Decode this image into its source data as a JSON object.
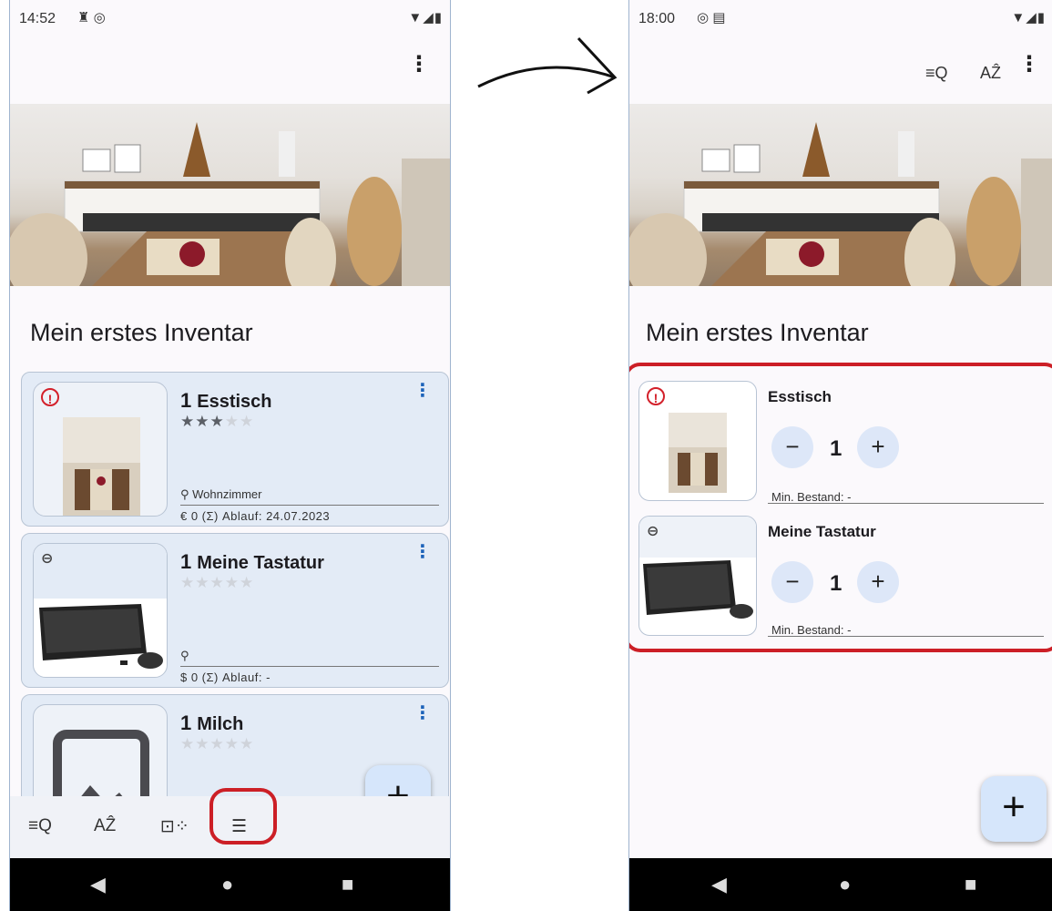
{
  "left": {
    "status_time": "14:52",
    "title": "Mein erstes Inventar",
    "cards": [
      {
        "qty": "1",
        "name": "Esstisch",
        "stars": 3,
        "location": "Wohnzimmer",
        "meta": "€ 0  (Σ)   Ablauf: 24.07.2023",
        "badge": "warn"
      },
      {
        "qty": "1",
        "name": "Meine Tastatur",
        "stars": 0,
        "location": "",
        "meta": "$ 0  (Σ)   Ablauf: -",
        "badge": "link"
      },
      {
        "qty": "1",
        "name": "Milch",
        "stars": 0,
        "location": "",
        "meta": "",
        "badge": ""
      }
    ],
    "bottom_nav": [
      "filter-search",
      "sort-az",
      "gallery-view",
      "list-view"
    ],
    "fab": "+"
  },
  "right": {
    "status_time": "18:00",
    "title": "Mein erstes Inventar",
    "items": [
      {
        "name": "Esstisch",
        "qty": "1",
        "min_stock": "Min. Bestand: -",
        "badge": "warn"
      },
      {
        "name": "Meine Tastatur",
        "qty": "1",
        "min_stock": "Min. Bestand: -",
        "badge": "link"
      }
    ],
    "fab": "+"
  },
  "glyphs": {
    "minus": "−",
    "plus": "+",
    "star": "★",
    "kebab": "⋮",
    "pin": "⚲",
    "back": "◀",
    "home": "●",
    "recent": "■"
  },
  "colors": {
    "accent_red": "#cc1f26",
    "card_bg": "#e3ebf6",
    "fab_bg": "#d6e6fb",
    "link_blue": "#1c62b9"
  }
}
